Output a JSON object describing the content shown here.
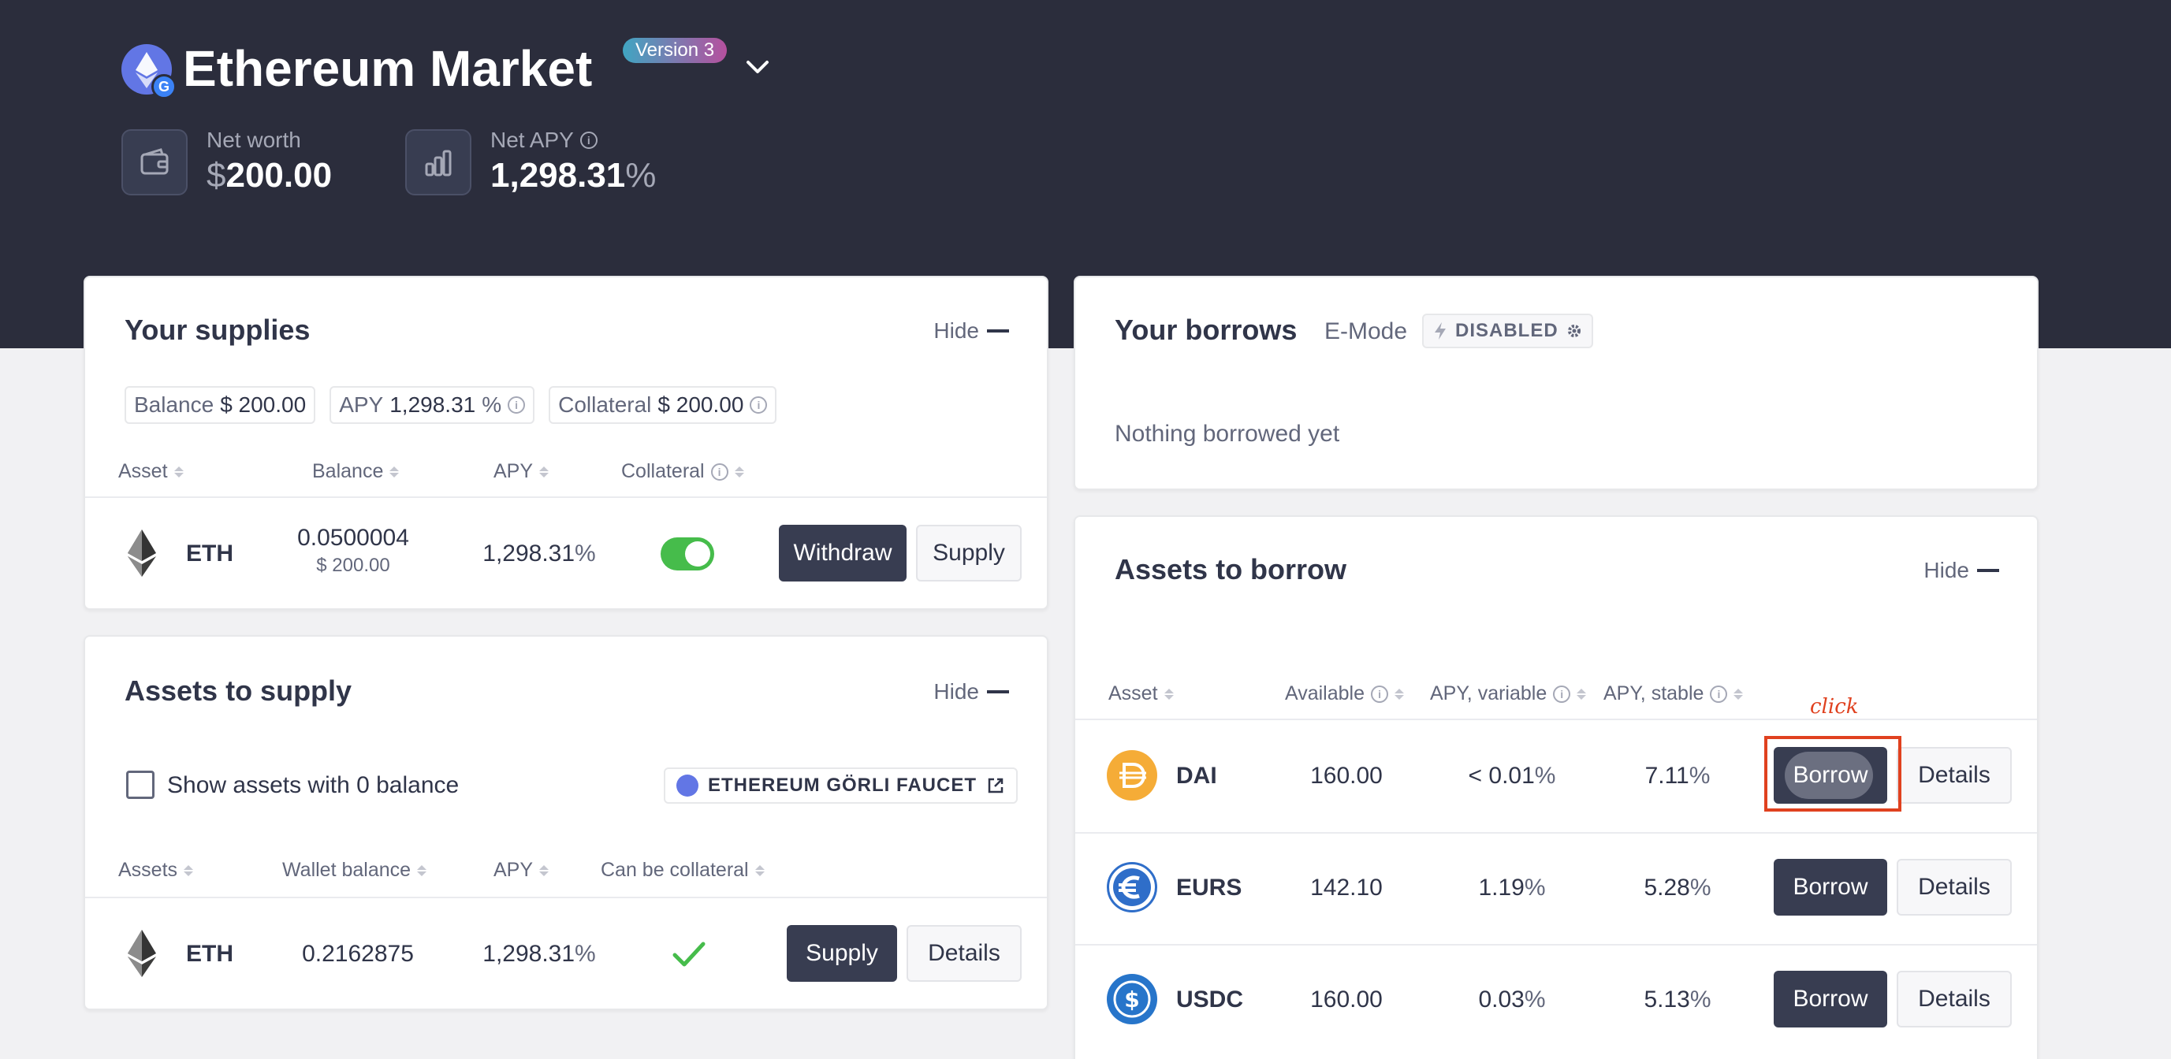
{
  "header": {
    "market_title": "Ethereum Market",
    "version_badge": "Version 3",
    "market_icon_badge": "G",
    "net_worth_label": "Net worth",
    "net_worth_symbol": "$",
    "net_worth_value": "200.00",
    "net_apy_label": "Net APY",
    "net_apy_value": "1,298.31",
    "net_apy_symbol": "%"
  },
  "supplies": {
    "title": "Your supplies",
    "hide_label": "Hide",
    "summary": {
      "balance_label": "Balance",
      "balance_value": "$ 200.00",
      "apy_label": "APY",
      "apy_value": "1,298.31",
      "apy_symbol": "%",
      "collateral_label": "Collateral",
      "collateral_value": "$ 200.00"
    },
    "columns": [
      "Asset",
      "Balance",
      "APY",
      "Collateral"
    ],
    "rows": [
      {
        "asset": "ETH",
        "balance": "0.0500004",
        "balance_usd": "$ 200.00",
        "apy": "1,298.31",
        "apy_symbol": "%",
        "collateral_enabled": true,
        "primary_action": "Withdraw",
        "secondary_action": "Supply"
      }
    ]
  },
  "assets_to_supply": {
    "title": "Assets to supply",
    "hide_label": "Hide",
    "show_zero_label": "Show assets with 0 balance",
    "faucet_label": "ETHEREUM GÖRLI FAUCET",
    "columns": [
      "Assets",
      "Wallet balance",
      "APY",
      "Can be collateral"
    ],
    "rows": [
      {
        "asset": "ETH",
        "wallet_balance": "0.2162875",
        "apy": "1,298.31",
        "apy_symbol": "%",
        "can_be_collateral": true,
        "primary_action": "Supply",
        "secondary_action": "Details"
      }
    ]
  },
  "borrows": {
    "title": "Your borrows",
    "emode_label": "E-Mode",
    "emode_status": "DISABLED",
    "empty_message": "Nothing borrowed yet"
  },
  "assets_to_borrow": {
    "title": "Assets to borrow",
    "hide_label": "Hide",
    "columns": [
      "Asset",
      "Available",
      "APY, variable",
      "APY, stable"
    ],
    "rows": [
      {
        "asset": "DAI",
        "available": "160.00",
        "apy_variable": "< 0.01",
        "apy_stable": "7.11",
        "primary_action": "Borrow",
        "secondary_action": "Details"
      },
      {
        "asset": "EURS",
        "available": "142.10",
        "apy_variable": "1.19",
        "apy_stable": "5.28",
        "primary_action": "Borrow",
        "secondary_action": "Details"
      },
      {
        "asset": "USDC",
        "available": "160.00",
        "apy_variable": "0.03",
        "apy_stable": "5.13",
        "primary_action": "Borrow",
        "secondary_action": "Details"
      }
    ],
    "percent_symbol": "%"
  },
  "annotation": {
    "text": "click"
  },
  "colors": {
    "header_bg": "#2b2d3c",
    "dark_button": "#383d51",
    "toggle_on": "#46bc4b",
    "annotation": "#e0411f",
    "dai": "#f5ac37",
    "eurs": "#2f6ec9",
    "usdc": "#2775ca"
  }
}
